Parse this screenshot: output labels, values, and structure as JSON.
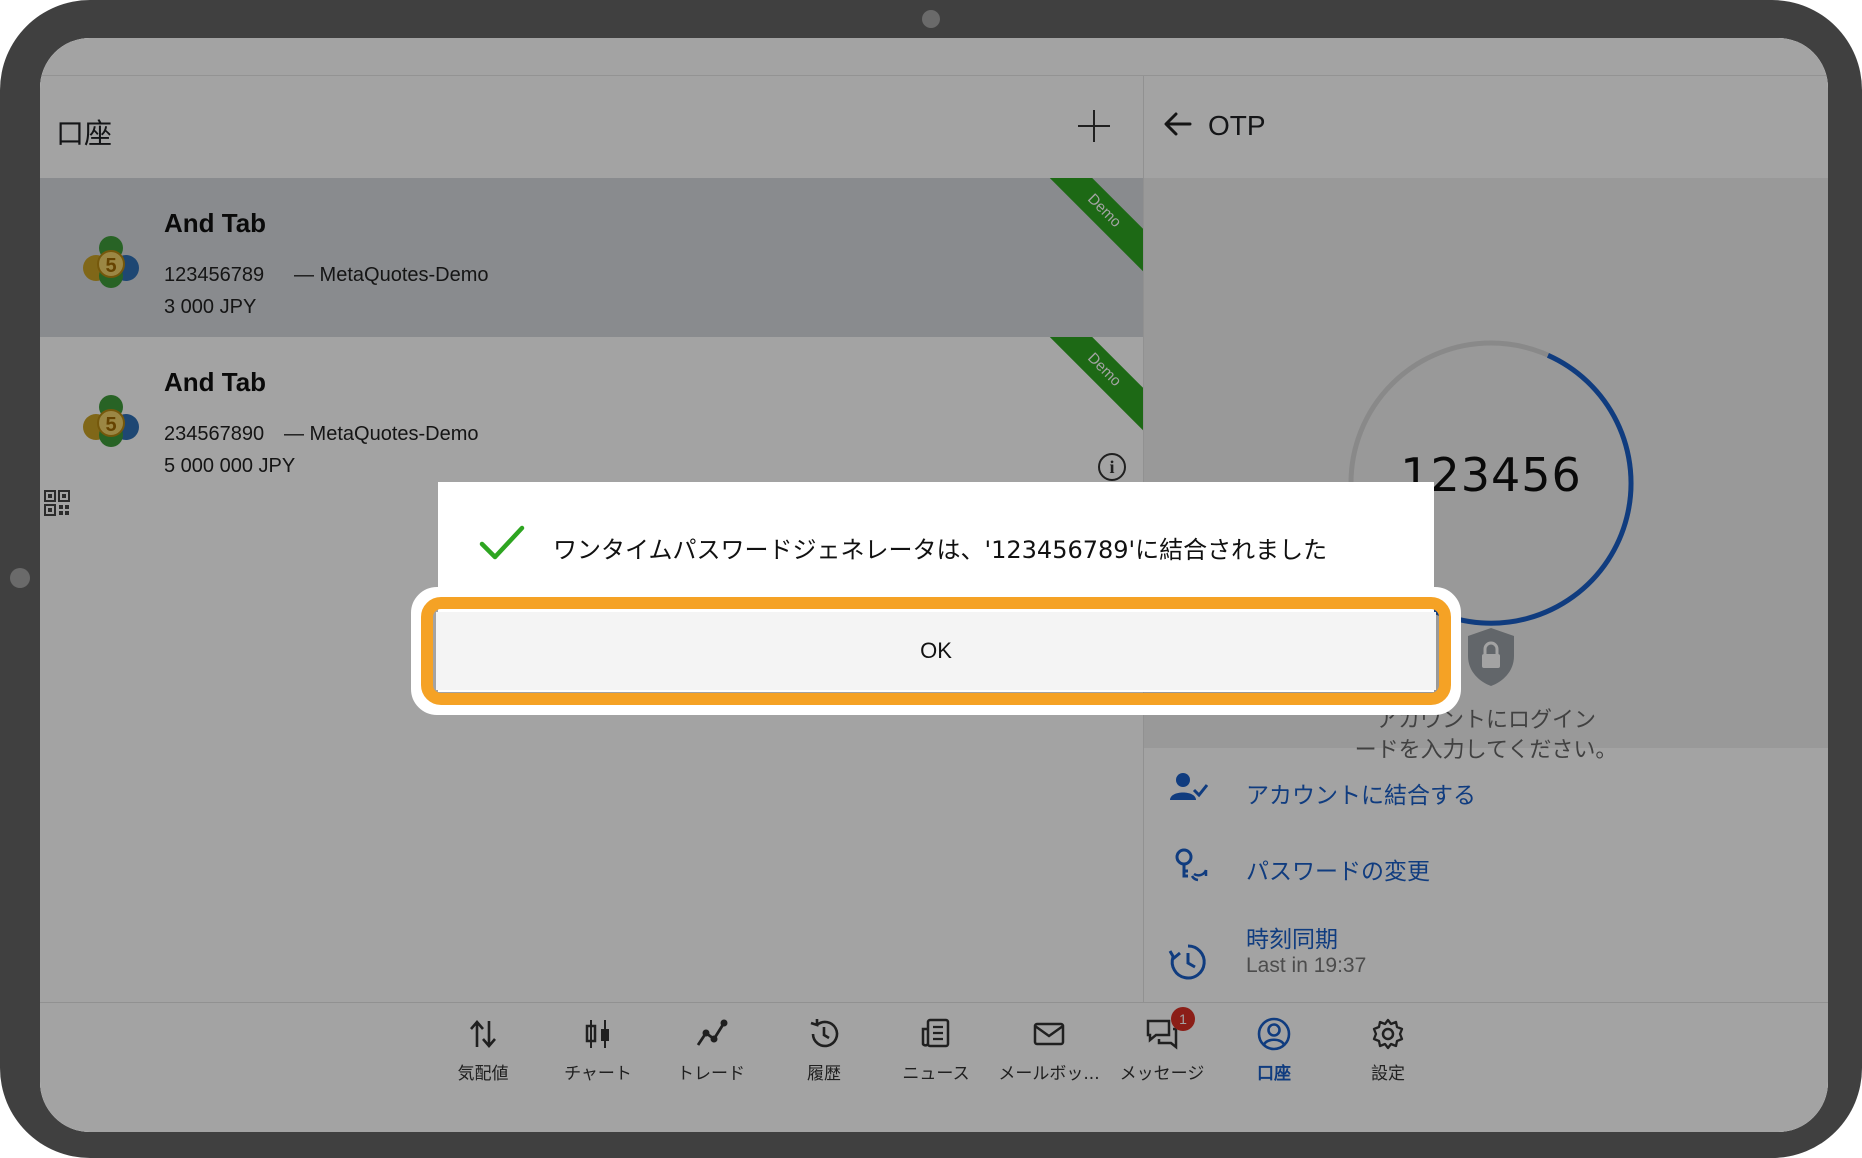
{
  "accounts_pane": {
    "title": "口座",
    "add_icon": "plus-icon",
    "accounts": [
      {
        "name": "And Tab",
        "number": "123456789",
        "server": "— MetaQuotes-Demo",
        "balance": "3 000 JPY",
        "badge": "Demo",
        "selected": true
      },
      {
        "name": "And Tab",
        "number": "234567890",
        "server": "— MetaQuotes-Demo",
        "balance": "5 000 000 JPY",
        "badge": "Demo",
        "selected": false
      }
    ]
  },
  "otp_pane": {
    "title": "OTP",
    "code": "123456",
    "description_line1": "アカウントにログイン",
    "description_line2": "ードを入力してください。",
    "menu": [
      {
        "label": "アカウントに結合する",
        "icon": "user-link-icon"
      },
      {
        "label": "パスワードの変更",
        "icon": "key-change-icon"
      },
      {
        "label": "時刻同期",
        "sub": "Last in 19:37",
        "icon": "clock-sync-icon"
      }
    ]
  },
  "bottom_nav": [
    {
      "label": "気配値",
      "icon": "quotes-icon"
    },
    {
      "label": "チャート",
      "icon": "candles-icon"
    },
    {
      "label": "トレード",
      "icon": "trade-icon"
    },
    {
      "label": "履歴",
      "icon": "history-icon"
    },
    {
      "label": "ニュース",
      "icon": "news-icon"
    },
    {
      "label": "メールボッ...",
      "icon": "mail-icon"
    },
    {
      "label": "メッセージ",
      "icon": "chat-icon",
      "badge": "1"
    },
    {
      "label": "口座",
      "icon": "account-icon",
      "active": true
    },
    {
      "label": "設定",
      "icon": "gear-icon"
    }
  ],
  "dialog": {
    "message": "ワンタイムパスワードジェネレータは、'123456789'に結合されました",
    "ok_label": "OK"
  },
  "colors": {
    "accent": "#1a5fc7",
    "demo_ribbon": "#2ea521",
    "highlight": "#f5a225",
    "check": "#2ea521",
    "badge": "#d93025"
  }
}
